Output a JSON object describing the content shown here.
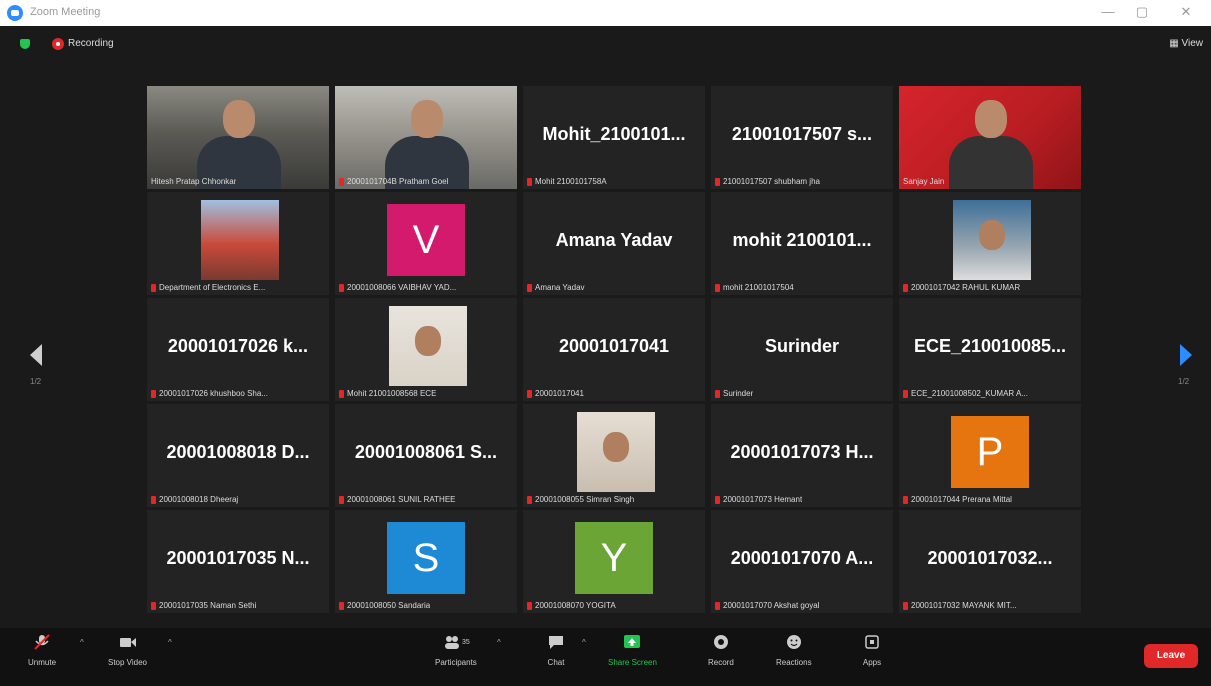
{
  "window": {
    "title": "Zoom Meeting",
    "controls": [
      "—",
      "▢",
      "✕"
    ]
  },
  "topbar": {
    "recording_label": "Recording",
    "view_label": "View"
  },
  "pagination": {
    "left_page": "1/2",
    "right_page": "1/2"
  },
  "tiles": [
    {
      "kind": "video",
      "label": "Hitesh Pratap Chhonkar",
      "muted": false,
      "active": false
    },
    {
      "kind": "video",
      "label": "2000101704B Pratham Goel",
      "muted": true,
      "active": false
    },
    {
      "kind": "name",
      "name": "Mohit_2100101...",
      "label": "Mohit 2100101758A",
      "muted": true,
      "active": false
    },
    {
      "kind": "name",
      "name": "21001017507 s...",
      "label": "21001017507 shubham jha",
      "muted": true,
      "active": false
    },
    {
      "kind": "video",
      "label": "Sanjay Jain",
      "muted": false,
      "active": true
    },
    {
      "kind": "video",
      "label": "Department of Electronics E...",
      "muted": true,
      "active": false
    },
    {
      "kind": "letter",
      "letter": "V",
      "color": "#d41a6c",
      "label": "20001008066 VAIBHAV YAD...",
      "muted": true,
      "active": false
    },
    {
      "kind": "name",
      "name": "Amana Yadav",
      "label": "Amana Yadav",
      "muted": true,
      "active": false
    },
    {
      "kind": "name",
      "name": "mohit 2100101...",
      "label": "mohit 21001017504",
      "muted": true,
      "active": false
    },
    {
      "kind": "video",
      "label": "20001017042 RAHUL KUMAR",
      "muted": true,
      "active": false
    },
    {
      "kind": "name",
      "name": "20001017026 k...",
      "label": "20001017026 khushboo Sha...",
      "muted": true,
      "active": false
    },
    {
      "kind": "video",
      "label": "Mohit 21001008568 ECE",
      "muted": true,
      "active": false
    },
    {
      "kind": "name",
      "name": "20001017041",
      "label": "20001017041",
      "muted": true,
      "active": false
    },
    {
      "kind": "name",
      "name": "Surinder",
      "label": "Surinder",
      "muted": true,
      "active": false
    },
    {
      "kind": "name",
      "name": "ECE_210010085...",
      "label": "ECE_21001008502_KUMAR A...",
      "muted": true,
      "active": false
    },
    {
      "kind": "name",
      "name": "20001008018 D...",
      "label": "20001008018 Dheeraj",
      "muted": true,
      "active": false
    },
    {
      "kind": "name",
      "name": "20001008061 S...",
      "label": "20001008061 SUNIL RATHEE",
      "muted": true,
      "active": false
    },
    {
      "kind": "video",
      "label": "20001008055 Simran Singh",
      "muted": true,
      "active": false
    },
    {
      "kind": "name",
      "name": "20001017073 H...",
      "label": "20001017073 Hemant",
      "muted": true,
      "active": false
    },
    {
      "kind": "letter",
      "letter": "P",
      "color": "#e67510",
      "label": "20001017044 Prerana Mittal",
      "muted": true,
      "active": false
    },
    {
      "kind": "name",
      "name": "20001017035 N...",
      "label": "20001017035 Naman Sethi",
      "muted": true,
      "active": false
    },
    {
      "kind": "letter",
      "letter": "S",
      "color": "#1e8ad6",
      "label": "20001008050 Sandaria",
      "muted": true,
      "active": false
    },
    {
      "kind": "letter",
      "letter": "Y",
      "color": "#6aa535",
      "label": "20001008070 YOGITA",
      "muted": true,
      "active": false
    },
    {
      "kind": "name",
      "name": "20001017070 A...",
      "label": "20001017070 Akshat goyal",
      "muted": true,
      "active": false
    },
    {
      "kind": "name",
      "name": "20001017032...",
      "label": "20001017032 MAYANK MIT...",
      "muted": true,
      "active": false
    }
  ],
  "toolbar": {
    "unmute": "Unmute",
    "stop_video": "Stop Video",
    "participants": "Participants",
    "participants_count": "35",
    "chat": "Chat",
    "share_screen": "Share Screen",
    "record": "Record",
    "reactions": "Reactions",
    "apps": "Apps",
    "leave": "Leave"
  },
  "colors": {
    "accent": "#2d8cff",
    "leave": "#e02828",
    "active_speaker": "#f0c419",
    "share_green": "#23c552"
  }
}
